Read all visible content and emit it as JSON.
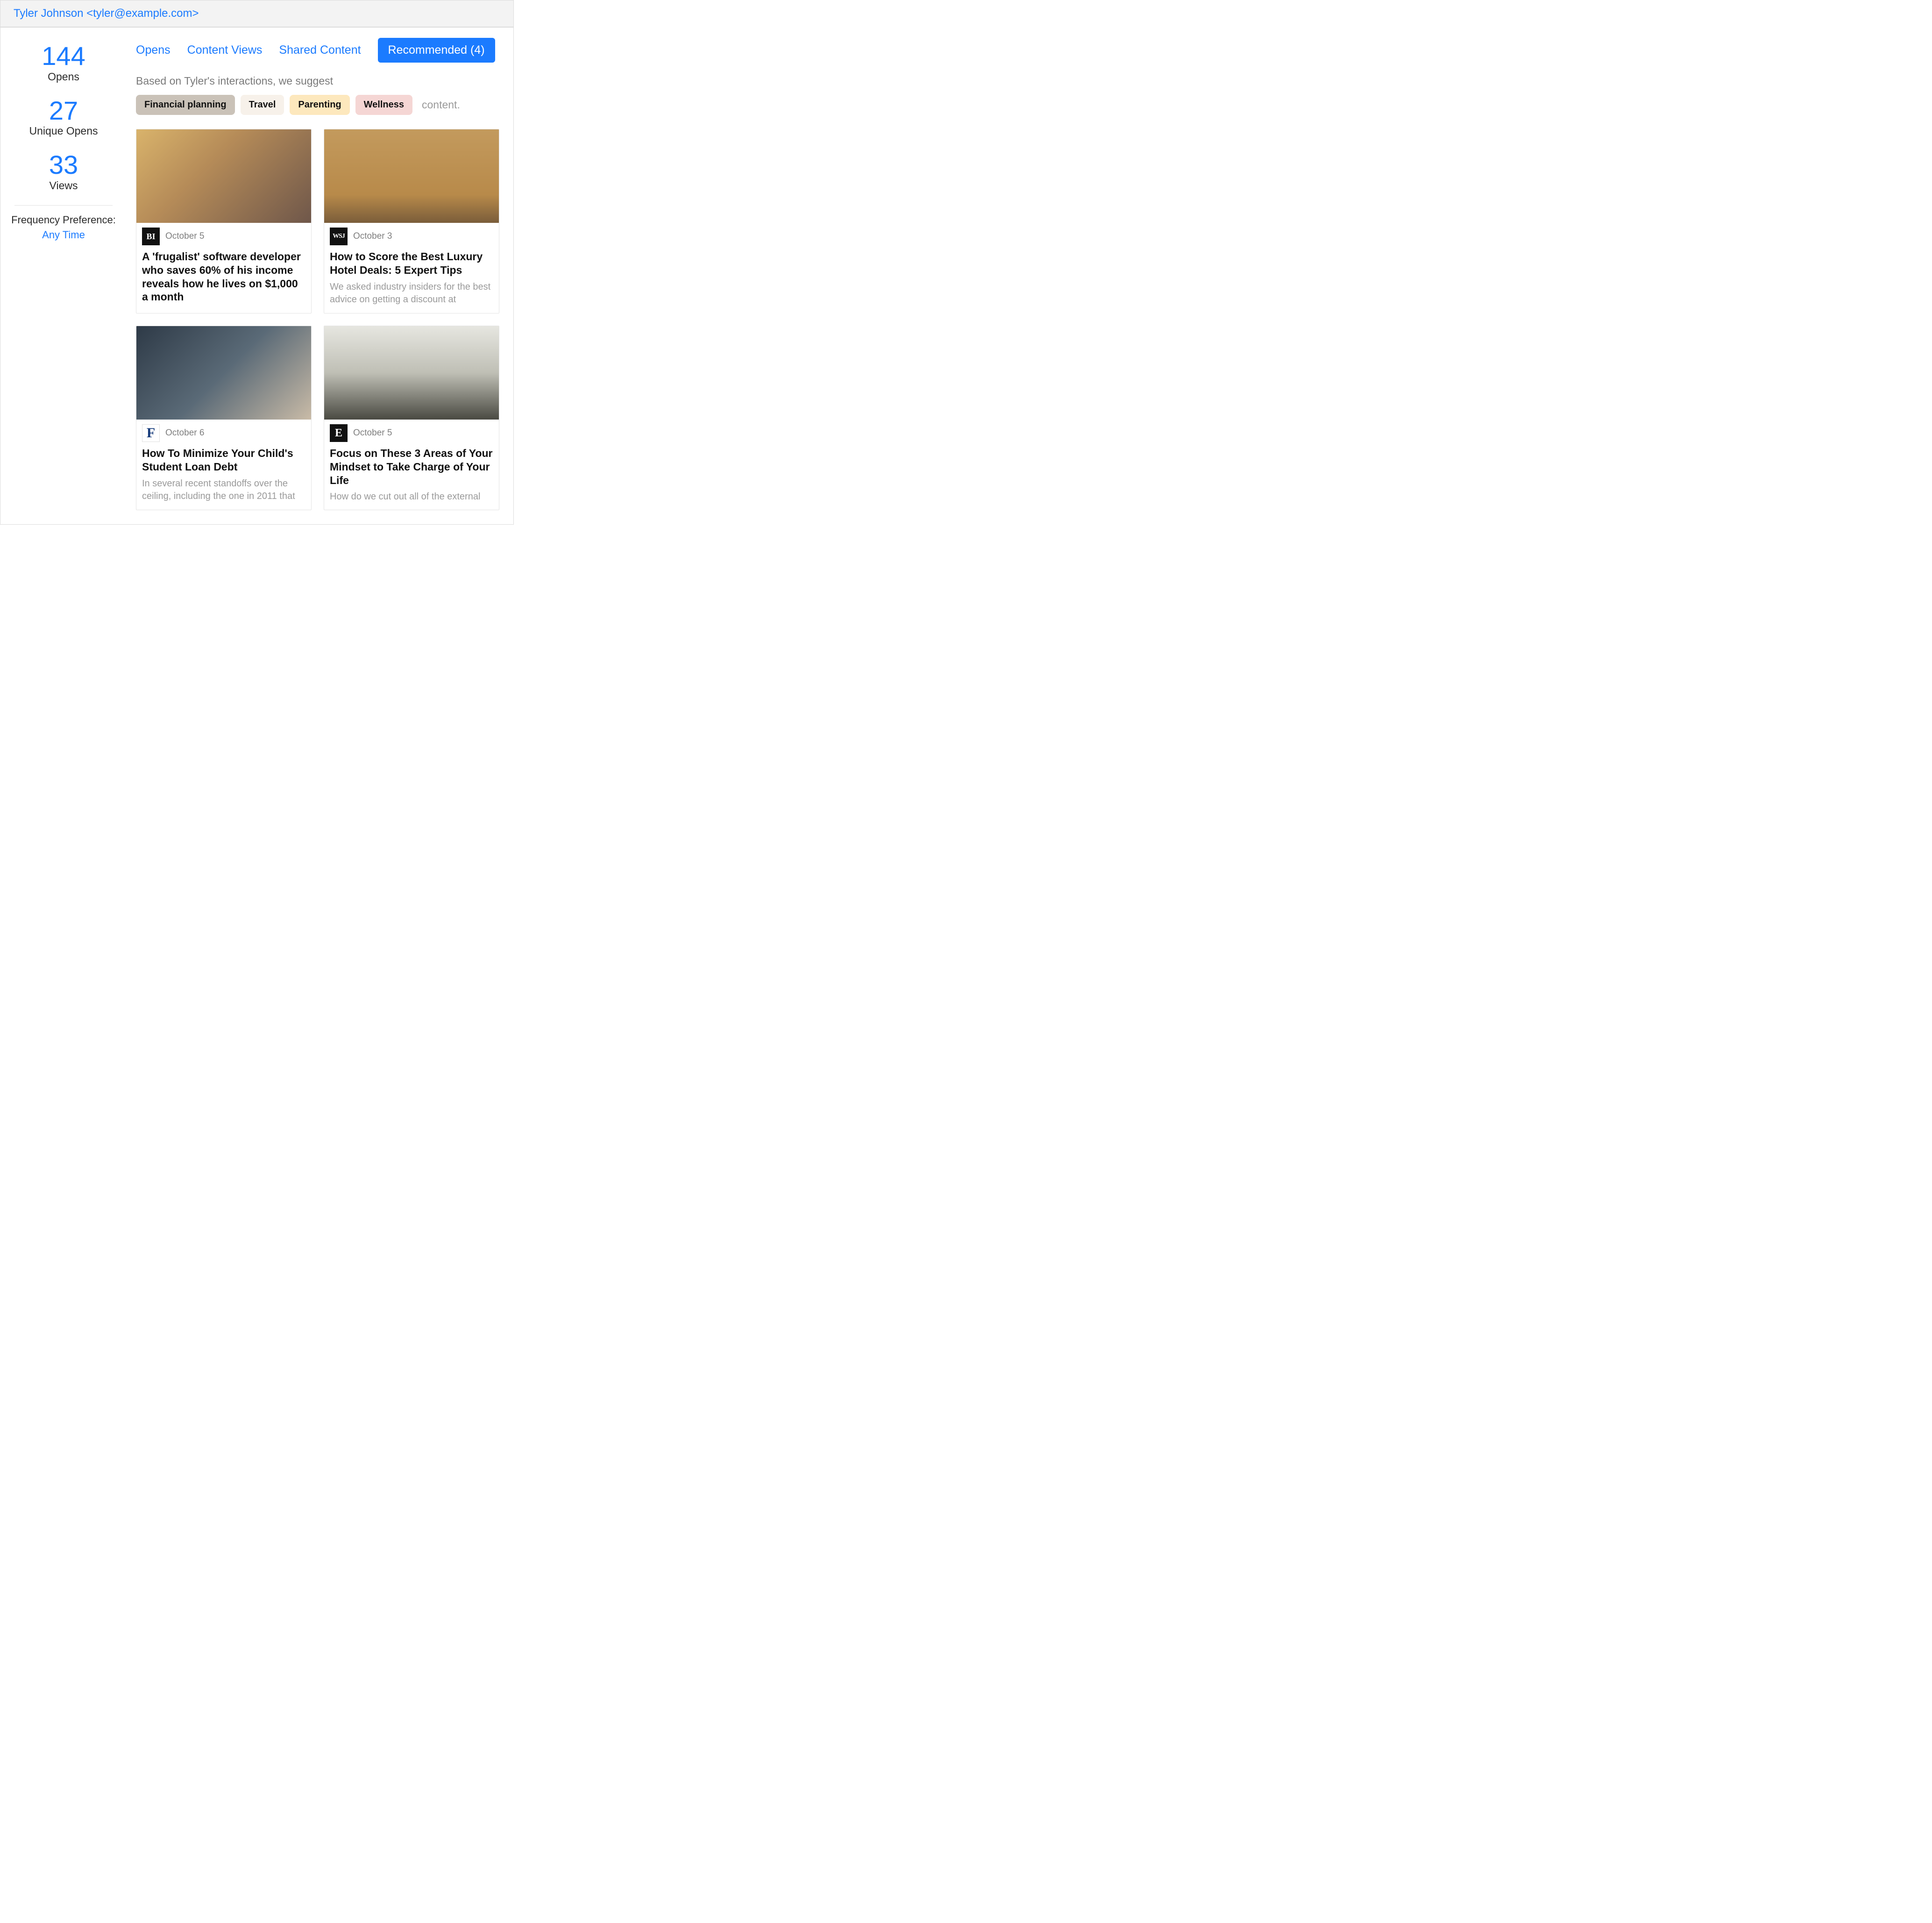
{
  "header": {
    "contact_name": "Tyler Johnson",
    "contact_email": "tyler@example.com",
    "display": "Tyler Johnson <tyler@example.com>"
  },
  "sidebar": {
    "stats": [
      {
        "value": "144",
        "label": "Opens"
      },
      {
        "value": "27",
        "label": "Unique Opens"
      },
      {
        "value": "33",
        "label": "Views"
      }
    ],
    "frequency": {
      "label": "Frequency Preference:",
      "value": "Any Time"
    }
  },
  "tabs": [
    {
      "label": "Opens",
      "active": false
    },
    {
      "label": "Content Views",
      "active": false
    },
    {
      "label": "Shared Content",
      "active": false
    },
    {
      "label": "Recommended (4)",
      "active": true
    }
  ],
  "suggest_line": "Based on Tyler's interactions, we suggest",
  "topic_chips": [
    "Financial planning",
    "Travel",
    "Parenting",
    "Wellness"
  ],
  "chips_suffix": "content.",
  "articles": [
    {
      "source_badge": "BI",
      "source_class": "src-bi",
      "date": "October 5",
      "title": "A 'frugalist' software developer who saves 60% of his income reveals how he lives on $1,000 a month",
      "excerpt": ""
    },
    {
      "source_badge": "WSJ",
      "source_class": "src-wsj",
      "date": "October 3",
      "title": "How to Score the Best Luxury Hotel Deals: 5 Expert Tips",
      "excerpt": "We asked industry insiders for the best advice on getting a discount at"
    },
    {
      "source_badge": "F",
      "source_class": "src-f",
      "date": "October 6",
      "title": "How To Minimize Your Child's Student Loan Debt",
      "excerpt": "In several recent standoffs over the ceiling, including the one in 2011 that"
    },
    {
      "source_badge": "E",
      "source_class": "src-e",
      "date": "October 5",
      "title": "Focus on These 3 Areas of Your Mindset to Take Charge of Your Life",
      "excerpt": "How do we cut out all of the external"
    }
  ]
}
